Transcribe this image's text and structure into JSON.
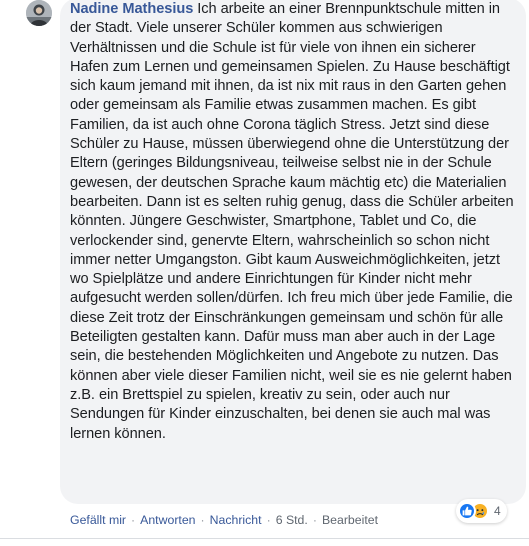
{
  "comment": {
    "author": "Nadine Mathesius",
    "text": "Ich arbeite an einer Brennpunktschule mitten in der Stadt. Viele unserer Schüler kommen aus schwierigen Verhältnissen und die Schule ist für viele von ihnen ein sicherer Hafen zum Lernen und gemeinsamen Spielen. Zu Hause beschäftigt sich kaum jemand mit ihnen, da ist nix mit raus in den Garten gehen oder gemeinsam als Familie etwas zusammen machen. Es gibt Familien, da ist auch ohne Corona täglich Stress. Jetzt sind diese Schüler zu Hause, müssen überwiegend ohne die Unterstützung der Eltern (geringes Bildungsniveau, teilweise selbst nie in der Schule gewesen, der deutschen Sprache kaum mächtig etc) die Materialien bearbeiten. Dann ist es selten ruhig genug, dass die Schüler arbeiten könnten. Jüngere Geschwister, Smartphone, Tablet und Co, die verlockender sind, genervte Eltern, wahrscheinlich so schon nicht immer netter Umgangston. Gibt kaum Ausweichmöglichkeiten, jetzt wo Spielplätze und andere Einrichtungen für Kinder nicht mehr aufgesucht werden sollen/dürfen. Ich freu mich über jede Familie, die diese Zeit trotz der Einschränkungen gemeinsam und schön für alle Beteiligten gestalten kann. Dafür muss man aber auch in der Lage sein, die bestehenden Möglichkeiten und Angebote zu nutzen. Das können aber viele dieser Familien nicht, weil sie es nie gelernt haben z.B. ein Brettspiel zu spielen, kreativ zu sein, oder auch nur Sendungen für Kinder einzuschalten, bei denen sie auch mal was lernen können.",
    "reactions": {
      "count": "4",
      "icons": [
        "like-icon",
        "sad-icon"
      ]
    },
    "actions": {
      "like": "Gefällt mir",
      "reply": "Antworten",
      "message": "Nachricht",
      "timestamp": "6 Std.",
      "edited": "Bearbeitet"
    }
  },
  "colors": {
    "author_link": "#385898",
    "bubble_bg": "#f2f3f5",
    "like_blue": "#1877f2",
    "sad_yellow": "#f7b125",
    "meta_gray": "#606770"
  }
}
